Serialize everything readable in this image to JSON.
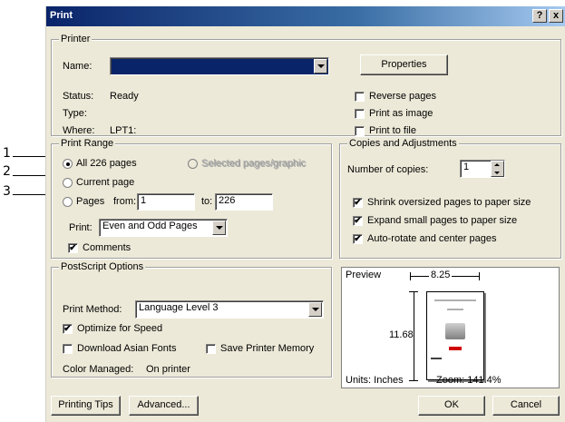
{
  "window": {
    "title": "Print",
    "help_btn": "?",
    "close_btn": "x"
  },
  "callouts": [
    "1",
    "2",
    "3"
  ],
  "printer": {
    "legend": "Printer",
    "name_label": "Name:",
    "name_value": "",
    "properties_button": "Properties",
    "status_label": "Status:",
    "status_value": "Ready",
    "type_label": "Type:",
    "type_value": "",
    "where_label": "Where:",
    "where_value": "LPT1:",
    "reverse_pages": "Reverse pages",
    "print_as_image": "Print as image",
    "print_to_file": "Print to file"
  },
  "print_range": {
    "legend": "Print Range",
    "all_pages": "All 226 pages",
    "selected_pages": "Selected pages/graphic",
    "current_page": "Current page",
    "pages": "Pages",
    "from_label": "from:",
    "from_value": "1",
    "to_label": "to:",
    "to_value": "226",
    "print_label": "Print:",
    "print_value": "Even and Odd Pages",
    "comments": "Comments"
  },
  "copies": {
    "legend": "Copies and Adjustments",
    "number_label": "Number of copies:",
    "number_value": "1",
    "shrink": "Shrink oversized pages to paper size",
    "expand": "Expand small pages to paper size",
    "autorotate": "Auto-rotate and center pages"
  },
  "postscript": {
    "legend": "PostScript Options",
    "method_label": "Print Method:",
    "method_value": "Language Level 3",
    "optimize": "Optimize for Speed",
    "asian_fonts": "Download Asian Fonts",
    "save_memory": "Save Printer Memory",
    "color_label": "Color Managed:",
    "color_value": "On printer"
  },
  "preview": {
    "label": "Preview",
    "width": "8.25",
    "height": "11.68",
    "units": "Units: Inches",
    "zoom": "Zoom: 141.4%"
  },
  "footer": {
    "printing_tips": "Printing Tips",
    "advanced": "Advanced...",
    "ok": "OK",
    "cancel": "Cancel"
  },
  "check_mark": "✔"
}
